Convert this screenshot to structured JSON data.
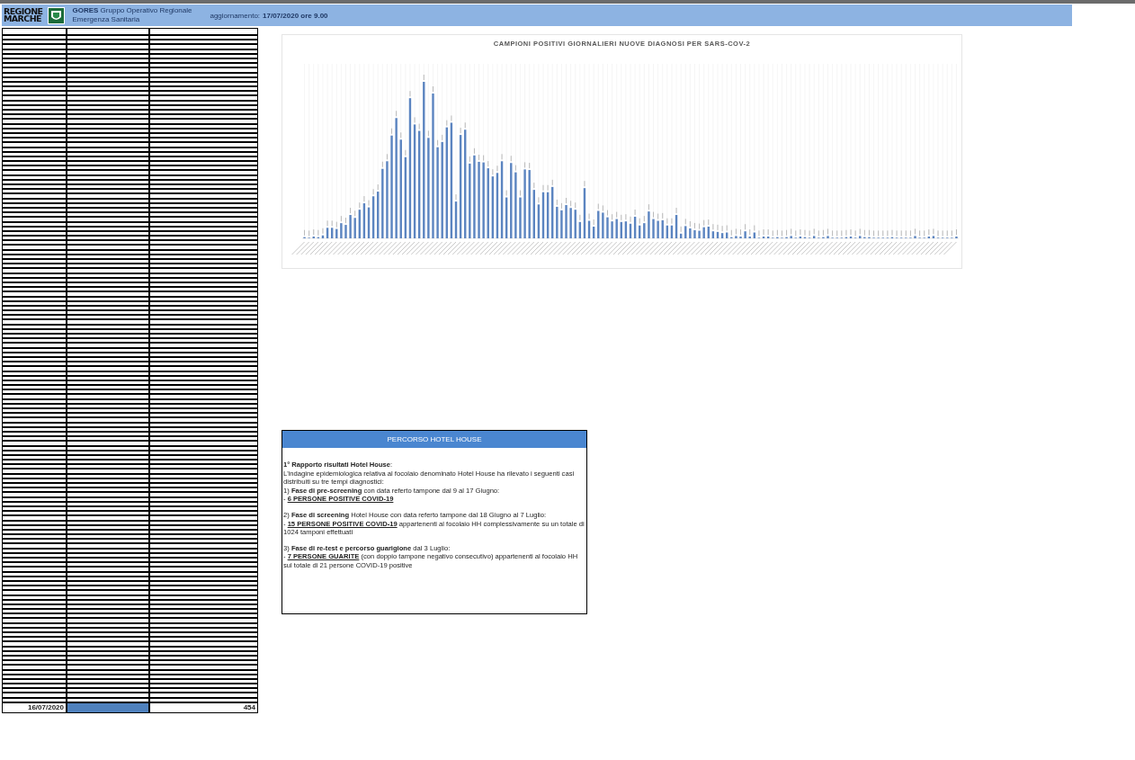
{
  "header": {
    "logo_text": [
      "REGIONE",
      "MARCHE"
    ],
    "org_name": "GORES",
    "org_desc": [
      "Gruppo Operativo Regionale",
      "Emergenza Sanitaria"
    ],
    "update_label": "aggiornamento:",
    "update_value": "17/07/2020 ore 9.00"
  },
  "table": {
    "last_row": {
      "date": "16/07/2020",
      "tests": "454",
      "highlighted": true
    }
  },
  "chart": {
    "title": "CAMPIONI POSITIVI GIORNALIERI NUOVE DIAGNOSI PER SARS-COV-2"
  },
  "info_box": {
    "title": "PERCORSO HOTEL HOUSE",
    "paragraphs": [
      [
        {
          "kind": "text",
          "text": "**1° Rapporto  risultati Hotel House**:"
        },
        {
          "kind": "text",
          "text": "L'indagine epidemiologica relativa al focolaio denominato Hotel House ha rilevato i seguenti casi distribuiti su tre tempi diagnostici:"
        },
        {
          "kind": "text",
          "text": "1) **Fase di pre-screening** con data referto tampone dal 9 al 17 Giugno:"
        },
        {
          "kind": "item",
          "prefix": "- ",
          "highlight": "6 PERSONE POSITIVE COVID-19"
        }
      ],
      [
        {
          "kind": "text",
          "text": "2) **Fase di screening** Hotel House con data referto tampone dal 18 Giugno al 7 Luglio:"
        },
        {
          "kind": "item",
          "prefix": "- ",
          "highlight": "15 PERSONE POSITIVE COVID-19",
          "rest": " appartenenti al focolaio HH complessivamente su un totale di 1024 tamponi effettuati"
        }
      ],
      [
        {
          "kind": "text",
          "text": "3) **Fase di re-test e percorso guarigione** dal 3 Luglio:"
        },
        {
          "kind": "item",
          "prefix": "- ",
          "highlight": "7 PERSONE GUARITE",
          "rest": " (con doppio tampone negativo consecutivo) appartenenti al focolaio HH sul totale di 21 persone COVID-19 positive"
        }
      ]
    ]
  }
}
